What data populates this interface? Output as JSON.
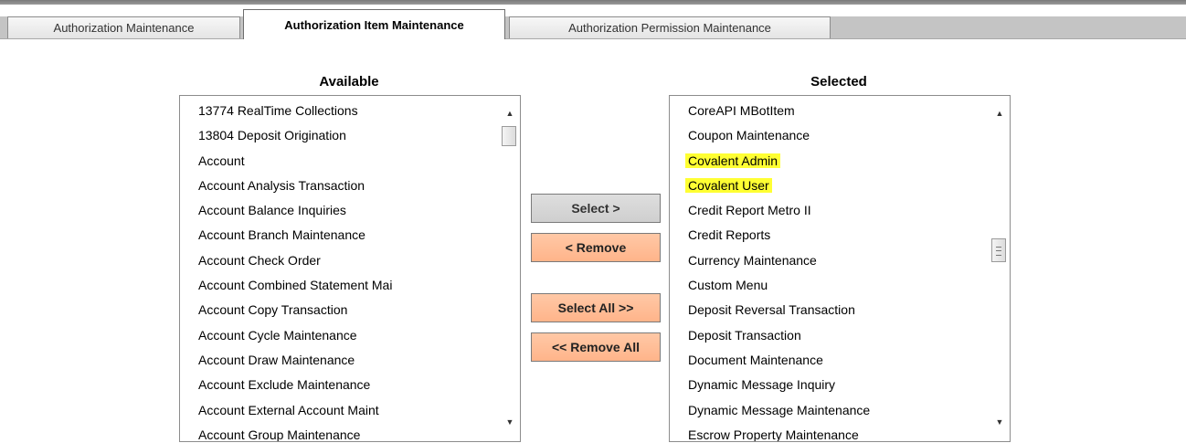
{
  "tabs": [
    {
      "label": "Authorization Maintenance",
      "active": false
    },
    {
      "label": "Authorization Item Maintenance",
      "active": true
    },
    {
      "label": "Authorization Permission Maintenance",
      "active": false
    }
  ],
  "available": {
    "heading": "Available",
    "items": [
      "13774 RealTime Collections",
      "13804 Deposit Origination",
      "Account",
      "Account Analysis Transaction",
      "Account Balance Inquiries",
      "Account Branch Maintenance",
      "Account Check Order",
      "Account Combined Statement Mai",
      "Account Copy Transaction",
      "Account Cycle Maintenance",
      "Account Draw Maintenance",
      "Account Exclude Maintenance",
      "Account External Account Maint",
      "Account Group Maintenance"
    ]
  },
  "selected": {
    "heading": "Selected",
    "items": [
      {
        "label": "CoreAPI MBotItem",
        "highlighted": false
      },
      {
        "label": "Coupon Maintenance",
        "highlighted": false
      },
      {
        "label": "Covalent Admin",
        "highlighted": true
      },
      {
        "label": "Covalent User",
        "highlighted": true
      },
      {
        "label": "Credit Report Metro II",
        "highlighted": false
      },
      {
        "label": "Credit Reports",
        "highlighted": false
      },
      {
        "label": "Currency Maintenance",
        "highlighted": false
      },
      {
        "label": "Custom Menu",
        "highlighted": false
      },
      {
        "label": "Deposit Reversal Transaction",
        "highlighted": false
      },
      {
        "label": "Deposit Transaction",
        "highlighted": false
      },
      {
        "label": "Document Maintenance",
        "highlighted": false
      },
      {
        "label": "Dynamic Message Inquiry",
        "highlighted": false
      },
      {
        "label": "Dynamic Message Maintenance",
        "highlighted": false
      },
      {
        "label": "Escrow Property Maintenance",
        "highlighted": false
      }
    ]
  },
  "buttons": {
    "select": "Select >",
    "remove": "< Remove",
    "select_all": "Select All >>",
    "remove_all": "<< Remove All"
  },
  "icons": {
    "scroll_up": "scroll-up-arrow-icon",
    "scroll_down": "scroll-down-arrow-icon"
  },
  "colors": {
    "highlight": "#ffff33",
    "remove_button": "#ffbe98",
    "select_button": "#d6d6d6"
  }
}
